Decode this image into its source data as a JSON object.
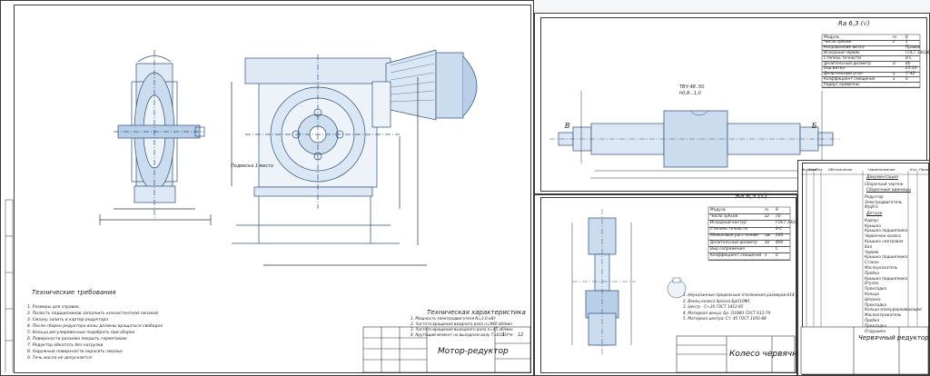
{
  "sheet1": {
    "title": "Мотор-редуктор",
    "sheet_no": "1",
    "sheets": "12",
    "tech_req_title": "Технические требования",
    "tech_req": [
      "1. Размеры для справок.",
      "2. Полость подшипников заполнить консистентной смазкой",
      "3. Смазку залить в картер редуктора",
      "4. После сборки редуктора валы должны вращаться свободно",
      "5. Кольца регулировочные подобрать при сборке",
      "6. Поверхности разъема покрыть герметиком",
      "7. Редуктор обкатать без нагрузки",
      "8. Наружные поверхности окрасить эмалью",
      "9. Течь масла не допускается"
    ],
    "tech_char_title": "Техническая характеристика",
    "tech_char": [
      "1. Мощность электродвигателя N=3.0 кВт",
      "2. Частота вращения входного вала n=940 об/мин",
      "3. Частота вращения выходного вала n=45 об/мин",
      "4. Крутящий момент на выходном валу T=610 Н*м"
    ],
    "callouts": [
      "23",
      "1",
      "15",
      "17",
      "26",
      "8",
      "22",
      "14",
      "20",
      "24",
      "3",
      "4",
      "6",
      "5",
      "7",
      "27",
      "9",
      "01",
      "04",
      "02",
      "07",
      "05"
    ],
    "dims": [
      "Ø200 Н7/s6",
      "Ø210 Н7/k6",
      "Ø240 Н7/h6",
      "243",
      "Ø4",
      "540",
      "570",
      "555",
      "503",
      "18"
    ],
    "note_label": "Подвеска 1 место"
  },
  "sheet2": {
    "surface_finish": "Ra 6,3 (√)",
    "table_rows": [
      [
        "Модуль",
        "m",
        "8"
      ],
      [
        "Число зубьев",
        "z",
        "1"
      ],
      [
        "Направление витка",
        "",
        "Правое"
      ],
      [
        "Исходный червяк",
        "",
        "ГОСТ 19036-73"
      ],
      [
        "Степень точности",
        "",
        "8-С"
      ],
      [
        "Делительный диаметр",
        "d",
        "80"
      ],
      [
        "Ход витка",
        "",
        "25,13"
      ],
      [
        "Делительный угол",
        "γ",
        "5°42'"
      ],
      [
        "Коэффициент смещения",
        "x",
        "0"
      ],
      [
        "Радиус кривизны",
        "",
        "-"
      ]
    ],
    "labels": [
      "В",
      "Б",
      "Поперечное",
      "Ra 6,3",
      "ТВЧ 48..50",
      "h0,8...1,0",
      "Б1",
      "В1"
    ],
    "dims": [
      "Ø45",
      "Ø50",
      "Ø55",
      "Ø58",
      "Ø80",
      "Ø96",
      "Ø50",
      "Ø45",
      "110",
      "225",
      "480",
      "52",
      "1,6"
    ]
  },
  "sheet3": {
    "title": "Колесо червячное",
    "sheet_no": "1",
    "sheets": "1",
    "surface_finish": "Ra 6,3 (√)",
    "table_rows": [
      [
        "Модуль",
        "m",
        "8"
      ],
      [
        "Число зубьев",
        "z2",
        "50"
      ],
      [
        "Исходный контур",
        "",
        "ГОСТ 19036-73"
      ],
      [
        "Степень точности",
        "",
        "8-С"
      ],
      [
        "Межосевое расстояние",
        "aw",
        "240"
      ],
      [
        "Делительный диаметр",
        "d2",
        "400"
      ],
      [
        "Вид сопряжения",
        "",
        "С"
      ],
      [
        "Коэффициент смещения",
        "x",
        "0"
      ]
    ],
    "notes": [
      "1. Неуказанные предельные отклонения размеров H14, h14, ±IT14/2",
      "2. Венец колеса бронза БрО10Ф1",
      "3. Центр - Сч 20 ГОСТ 1412-85",
      "4. Материал венца: Бр. О10Ф1 ГОСТ 613-79",
      "5. Материал центра: Ст. 45 ГОСТ 1050-88"
    ],
    "callouts": [
      "1",
      "2",
      "3",
      "4",
      "5"
    ],
    "dims": [
      "Ø400",
      "Ø412",
      "Ø430",
      "Ø75",
      "Ø62",
      "Ø280",
      "70",
      "R6",
      "4 отв.Ø17"
    ]
  },
  "sheet4": {
    "title": "Червячный редуктор",
    "header": [
      "Формат",
      "Зона",
      "Поз.",
      "Обозначение",
      "Наименование",
      "Кол.",
      "Приме-чание"
    ],
    "sections": [
      {
        "name": "Документация",
        "items": [
          "Сборочный чертеж"
        ]
      },
      {
        "name": "Сборочные единицы",
        "items": [
          "Редуктор",
          "Электродвигатель",
          "Муфта"
        ]
      },
      {
        "name": "Детали",
        "items": [
          "Корпус",
          "Крышка",
          "Крышка подшипника",
          "Червячное колесо",
          "Крышка смотровая",
          "Вал",
          "Червяк",
          "Крышка подшипника",
          "Стакан",
          "Маслоуказатель",
          "Пробка",
          "Крышка подшипника",
          "Втулка",
          "Прокладка",
          "Кольцо",
          "Шпонка",
          "Прокладка",
          "Кольцо мазеудерживающее",
          "Маслоотражатель",
          "Пробка",
          "Прокладка",
          "Отдушина"
        ]
      }
    ]
  },
  "stamp_cells": [
    "Изм.",
    "Лист",
    "№ докум.",
    "Подп.",
    "Дата",
    "Разраб.",
    "Пров.",
    "Т.контр.",
    "Н.контр.",
    "Утв.",
    "Лит.",
    "Масса",
    "Масштаб",
    "Лист",
    "Листов",
    "Копировал",
    "Формат A1"
  ]
}
